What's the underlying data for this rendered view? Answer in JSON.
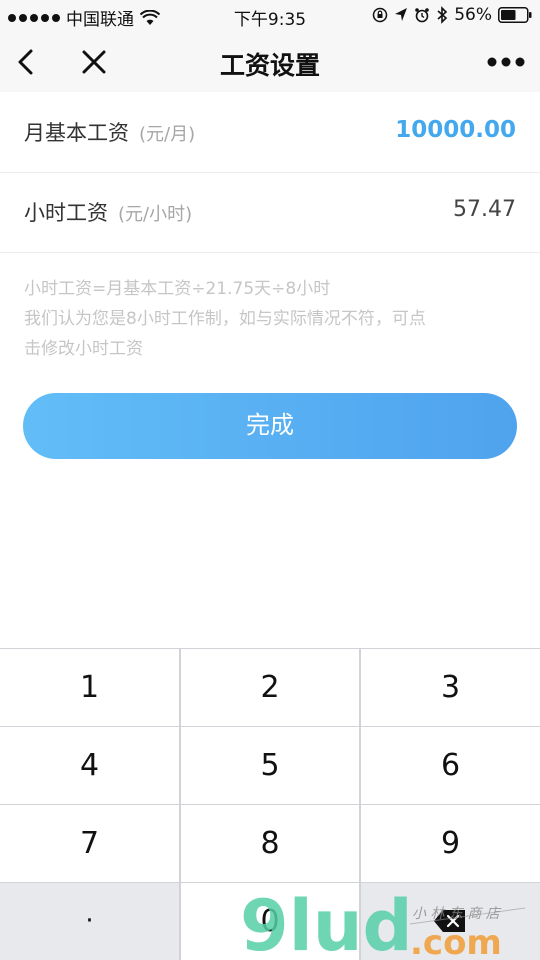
{
  "status_bar": {
    "carrier": "中国联通",
    "time": "下午9:35",
    "battery": "56%"
  },
  "nav": {
    "title": "工资设置"
  },
  "rows": [
    {
      "label": "月基本工资",
      "unit": "(元/月)",
      "value": "10000.00"
    },
    {
      "label": "小时工资",
      "unit": "(元/小时)",
      "value": "57.47"
    }
  ],
  "hint": {
    "line1": "小时工资=月基本工资÷21.75天÷8小时",
    "line2": "我们认为您是8小时工作制，如与实际情况不符，可点",
    "line3": "击修改小时工资"
  },
  "done_button": {
    "label": "完成"
  },
  "keyboard": {
    "keys": [
      "1",
      "2",
      "3",
      "4",
      "5",
      "6",
      "7",
      "8",
      "9",
      "·",
      "0"
    ]
  },
  "watermark": {
    "brand": "9lud",
    "suffix": ".com",
    "cn": "小 林 东 商 店"
  },
  "colors": {
    "accent": "#44a8ef",
    "button_start": "#62bdf7",
    "button_end": "#4fa3ee"
  }
}
